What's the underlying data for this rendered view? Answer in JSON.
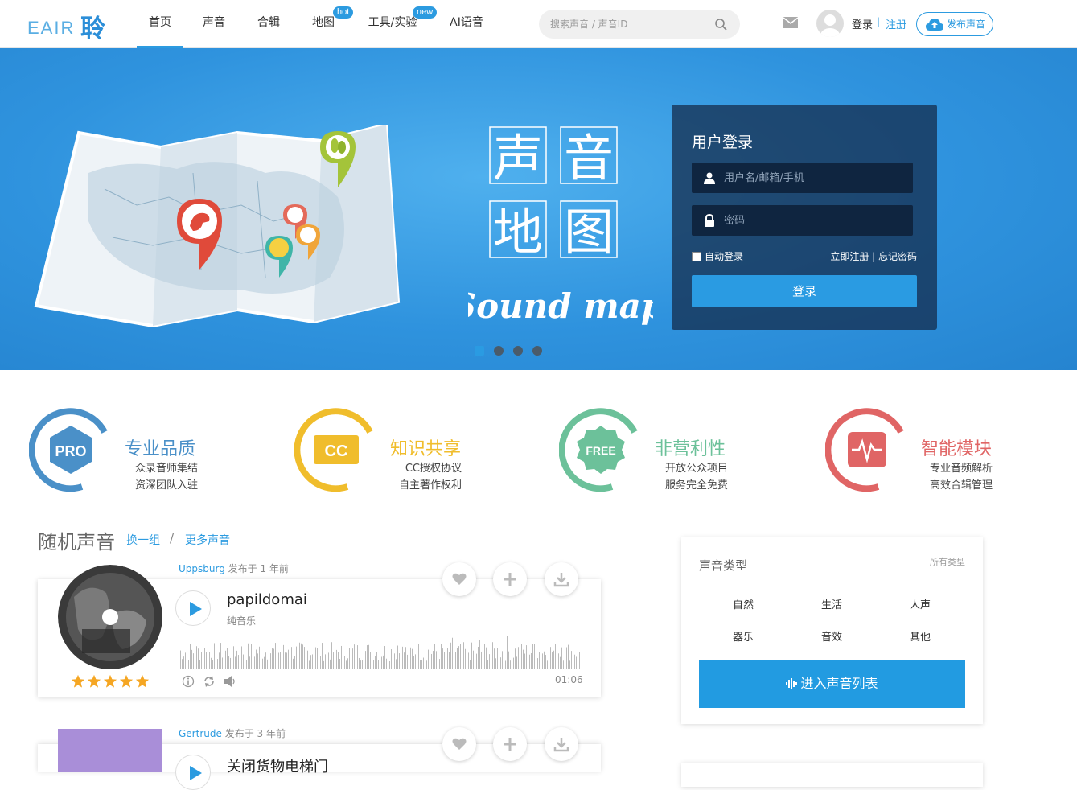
{
  "header": {
    "logo_text": "EAIR",
    "logo_char": "聆",
    "nav": [
      {
        "label": "首页",
        "badge": ""
      },
      {
        "label": "声音",
        "badge": ""
      },
      {
        "label": "合辑",
        "badge": ""
      },
      {
        "label": "地图",
        "badge": "hot"
      },
      {
        "label": "工具/实验",
        "badge": "new"
      },
      {
        "label": "AI语音",
        "badge": ""
      }
    ],
    "search_placeholder": "搜索声音 / 声音ID",
    "login": "登录",
    "sep": "|",
    "register": "注册",
    "publish": "发布声音"
  },
  "banner": {
    "title_chars": [
      "声",
      "音",
      "地",
      "图"
    ],
    "title_script": "Sound map",
    "login_title": "用户登录",
    "username_placeholder": "用户名/邮箱/手机",
    "password_placeholder": "密码",
    "remember": "自动登录",
    "links": "立即注册 | 忘记密码",
    "login_button": "登录",
    "slide_count": 4,
    "active_slide": 1
  },
  "features": [
    {
      "title": "专业品质",
      "badge": "PRO",
      "lines": [
        "众录音师集结",
        "资深团队入驻"
      ],
      "color": "#4a90c8"
    },
    {
      "title": "知识共享",
      "badge": "CC",
      "lines": [
        "CC授权协议",
        "自主著作权利"
      ],
      "color": "#f0bd2c"
    },
    {
      "title": "非营利性",
      "badge": "FREE",
      "lines": [
        "开放公众项目",
        "服务完全免费"
      ],
      "color": "#6cc19a"
    },
    {
      "title": "智能模块",
      "badge": "",
      "lines": [
        "专业音频解析",
        "高效合辑管理"
      ],
      "color": "#e06565"
    }
  ],
  "random": {
    "title": "随机声音",
    "refresh": "换一组",
    "sep": "/",
    "more": "更多声音",
    "items": [
      {
        "user": "Uppsburg",
        "meta": "发布于 1 年前",
        "title": "papildomai",
        "category": "纯音乐",
        "duration": "01:06",
        "rating": 5
      },
      {
        "user": "Gertrude",
        "meta": "发布于 3 年前",
        "title": "关闭货物电梯门",
        "category": "",
        "duration": "",
        "rating": 0
      }
    ]
  },
  "types": {
    "title": "声音类型",
    "all": "所有类型",
    "items": [
      "自然",
      "生活",
      "人声",
      "器乐",
      "音效",
      "其他"
    ],
    "button": "进入声音列表"
  },
  "colors": {
    "accent": "#2c9be0",
    "banner": "#2f93de",
    "panel": "#14283f"
  }
}
